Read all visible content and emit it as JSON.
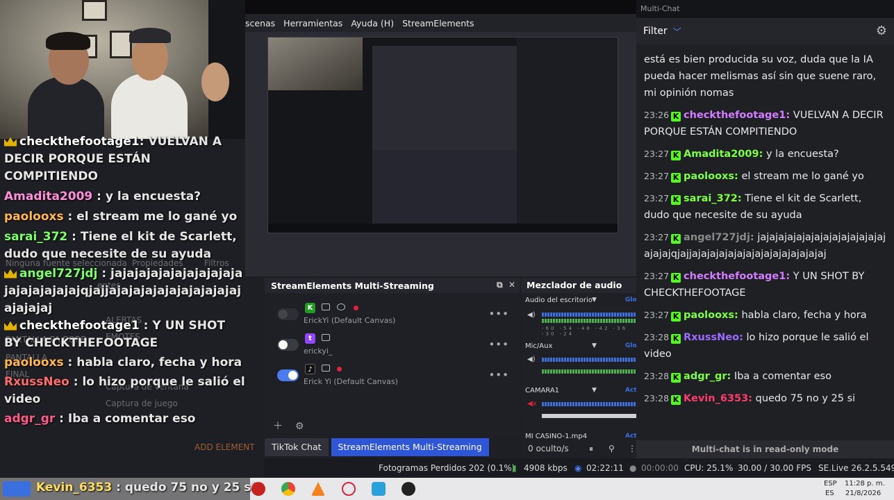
{
  "menu": {
    "items": [
      "scenas",
      "Herramientas",
      "Ayuda (H)",
      "StreamElements"
    ]
  },
  "overlay_chat": [
    {
      "user": "checkthefootage1",
      "text": ": VUELVAN A DECIR PORQUE ESTÁN COMPITIENDO",
      "color": "#ffffff",
      "badge": true
    },
    {
      "user": "Amadita2009",
      "text": " : y la encuesta?",
      "color": "#ff8fd8",
      "badge": false
    },
    {
      "user": "paolooxs",
      "text": " : el stream me lo gané yo",
      "color": "#ffb84d",
      "badge": false
    },
    {
      "user": "sarai_372",
      "text": " : Tiene el kit de Scarlett, dudo que necesite de su ayuda",
      "color": "#7dff6b",
      "badge": false
    },
    {
      "user": "angel727jdj",
      "text": " : jajajajajajajajajajajajajajajajajajqjajjajajajajajajajajajajajajajajaj",
      "color": "#7dff6b",
      "badge": true
    },
    {
      "user": "checkthefootage1",
      "text": " : Y UN SHOT BY CHECKTHEFOOTAGE",
      "color": "#ffffff",
      "badge": true
    },
    {
      "user": "paolooxs",
      "text": " : habla claro, fecha y hora",
      "color": "#ffb84d",
      "badge": false
    },
    {
      "user": "RxussNeo",
      "text": " : lo hizo porque le salió el video",
      "color": "#ff6b6b",
      "badge": false
    },
    {
      "user": "adgr_gr",
      "text": " : Iba a comentar eso",
      "color": "#ff5b8a",
      "badge": false
    },
    {
      "user": "Kevin_6353",
      "text": " : quedo 75 no y 25 si",
      "color": "#ffde59",
      "badge": false
    }
  ],
  "faint_labels": {
    "filtros": "Filtros",
    "fuentes": "entes",
    "alertas": "ALERTAS",
    "emotes": "EMOTES",
    "pantalla_borr": "PANTALLA PA BORR",
    "pantalla": "PANTALLA",
    "final": "FINAL",
    "captura_ventana": "Captura de ventana",
    "captura_juego": "Captura de juego",
    "add_element": "ADD ELEMENT",
    "ninguna": "Ninguna fuente seleccionada",
    "propiedades": "Propiedades"
  },
  "multistream": {
    "title": "StreamElements Multi-Streaming",
    "rows": [
      {
        "service": "kick",
        "name": "ErickYi (Default Canvas)",
        "enabled": false,
        "live": true
      },
      {
        "service": "twitch",
        "name": "erickyi_",
        "enabled": false,
        "live": false
      },
      {
        "service": "tiktok",
        "name": "Erick Yi (Default Canvas)",
        "enabled": true,
        "live": true
      }
    ]
  },
  "tabs": [
    {
      "label": "TikTok Chat",
      "active": false
    },
    {
      "label": "StreamElements Multi-Streaming",
      "active": true
    }
  ],
  "mixer": {
    "title": "Mezclador de audio",
    "channels": [
      {
        "name": "Audio del escritorio",
        "tag": "Glob"
      },
      {
        "name": "Mic/Aux",
        "tag": "Glob"
      },
      {
        "name": "CAMARA1",
        "tag": "Acti"
      },
      {
        "name": "MI CASINO-1.mp4",
        "tag": "Acti"
      }
    ],
    "scale": "-60 -54 -48 -42 -36 -30 -24",
    "hidden_label": "0 oculto/s"
  },
  "status": {
    "dropped": "Fotogramas Perdidos 202 (0.1%)",
    "bitrate": "4908 kbps",
    "stream_time": "02:22:11",
    "rec_time": "00:00:00",
    "cpu": "CPU: 25.1%",
    "fps": "30.00 / 30.00 FPS",
    "version": "SE.Live 26.2.5.549"
  },
  "multichat": {
    "window_title": "Multi-Chat",
    "filter_label": "Filter",
    "messages": [
      {
        "time": "",
        "user": "",
        "text": "está es bien producida su voz, duda que la IA pueda hacer melismas así sin que suene raro, mi opinión nomas",
        "color": "#e8e8e8"
      },
      {
        "time": "23:26",
        "user": "checkthefootage1:",
        "text": " VUELVAN A DECIR PORQUE ESTÁN COMPITIENDO",
        "color": "#d27cff"
      },
      {
        "time": "23:27",
        "user": "Amadita2009:",
        "text": " y la encuesta?",
        "color": "#7dff3f"
      },
      {
        "time": "23:27",
        "user": "paolooxs:",
        "text": " el stream me lo gané yo",
        "color": "#7dff3f"
      },
      {
        "time": "23:27",
        "user": "sarai_372:",
        "text": " Tiene el kit de Scarlett, dudo que necesite de su ayuda",
        "color": "#7dff3f"
      },
      {
        "time": "23:27",
        "user": "angel727jdj:",
        "text": " jajajajajajajajajajajajajajajajajajqjajjajajajajajajajajajajajajajajaj",
        "color": "#8a8a8a"
      },
      {
        "time": "23:27",
        "user": "checkthefootage1:",
        "text": " Y UN SHOT BY CHECKTHEFOOTAGE",
        "color": "#d27cff"
      },
      {
        "time": "23:27",
        "user": "paolooxs:",
        "text": " habla claro, fecha y hora",
        "color": "#7dff3f"
      },
      {
        "time": "23:28",
        "user": "RxussNeo:",
        "text": " lo hizo porque le salió el video",
        "color": "#9b6bff"
      },
      {
        "time": "23:28",
        "user": "adgr_gr:",
        "text": " Iba a comentar eso",
        "color": "#7dff3f"
      },
      {
        "time": "23:28",
        "user": "Kevin_6353:",
        "text": " quedo 75 no y 25 si",
        "color": "#ff3b6b"
      }
    ],
    "footer": "Multi-chat is in read-only mode"
  },
  "taskbar": {
    "lang": "ESP",
    "region": "ES",
    "time": "11:28 p. m.",
    "date": "21/8/2026"
  }
}
